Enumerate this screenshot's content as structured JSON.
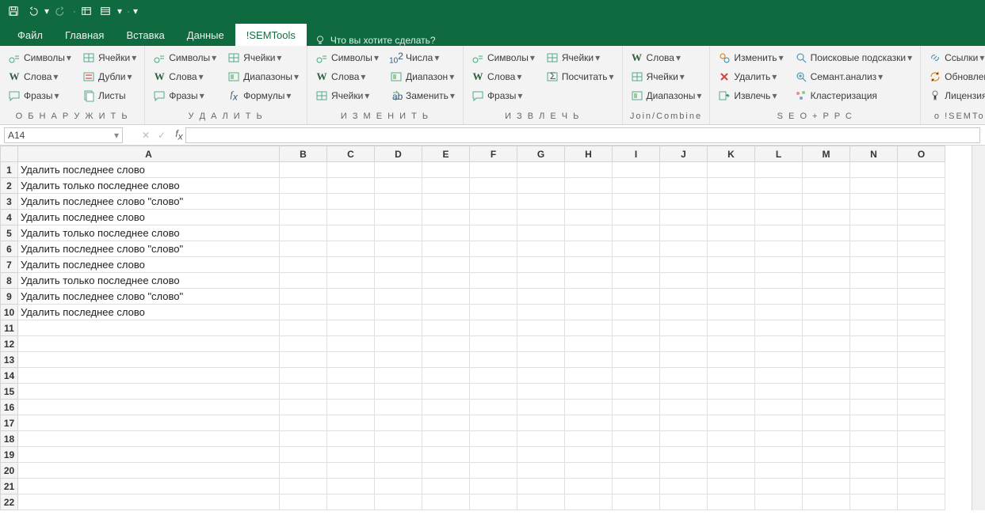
{
  "qat": {
    "save": "",
    "undo": "",
    "redo": ""
  },
  "tabs": {
    "file": "Файл",
    "home": "Главная",
    "insert": "Вставка",
    "data": "Данные",
    "semtools": "!SEMTools",
    "tellme": "Что вы хотите сделать?"
  },
  "ribbon": {
    "groups": [
      {
        "label": "О Б Н А Р У Ж И Т Ь",
        "cols": [
          [
            {
              "ic": "sym",
              "t": "Символы",
              "dd": 1
            },
            {
              "ic": "w",
              "t": "Слова",
              "dd": 1
            },
            {
              "ic": "phr",
              "t": "Фразы",
              "dd": 1
            }
          ],
          [
            {
              "ic": "cells",
              "t": "Ячейки",
              "dd": 1
            },
            {
              "ic": "dup",
              "t": "Дубли",
              "dd": 1
            },
            {
              "ic": "sheets",
              "t": "Листы"
            }
          ]
        ]
      },
      {
        "label": "У Д А Л И Т Ь",
        "cols": [
          [
            {
              "ic": "sym",
              "t": "Символы",
              "dd": 1
            },
            {
              "ic": "w",
              "t": "Слова",
              "dd": 1
            },
            {
              "ic": "phr",
              "t": "Фразы",
              "dd": 1
            }
          ],
          [
            {
              "ic": "cells",
              "t": "Ячейки",
              "dd": 1
            },
            {
              "ic": "rng",
              "t": "Диапазоны",
              "dd": 1
            },
            {
              "ic": "fx",
              "t": "Формулы",
              "dd": 1
            }
          ]
        ]
      },
      {
        "label": "И З М Е Н И Т Ь",
        "cols": [
          [
            {
              "ic": "sym",
              "t": "Символы",
              "dd": 1
            },
            {
              "ic": "w",
              "t": "Слова",
              "dd": 1
            },
            {
              "ic": "cells",
              "t": "Ячейки",
              "dd": 1
            }
          ],
          [
            {
              "ic": "num",
              "t": "Числа",
              "dd": 1
            },
            {
              "ic": "rng",
              "t": "Диапазон",
              "dd": 1
            },
            {
              "ic": "repl",
              "t": "Заменить",
              "dd": 1
            }
          ]
        ]
      },
      {
        "label": "И З В Л Е Ч Ь",
        "cols": [
          [
            {
              "ic": "sym",
              "t": "Символы",
              "dd": 1
            },
            {
              "ic": "w",
              "t": "Слова",
              "dd": 1
            },
            {
              "ic": "phr",
              "t": "Фразы",
              "dd": 1
            }
          ],
          [
            {
              "ic": "cells",
              "t": "Ячейки",
              "dd": 1
            },
            {
              "ic": "cnt",
              "t": "Посчитать",
              "dd": 1
            }
          ]
        ]
      },
      {
        "label": "Join/Combine",
        "cols": [
          [
            {
              "ic": "w",
              "t": "Слова",
              "dd": 1
            },
            {
              "ic": "cells",
              "t": "Ячейки",
              "dd": 1
            },
            {
              "ic": "rng",
              "t": "Диапазоны",
              "dd": 1
            }
          ]
        ]
      },
      {
        "label": "S E O + P P C",
        "cols": [
          [
            {
              "ic": "edit",
              "t": "Изменить",
              "dd": 1
            },
            {
              "ic": "del",
              "t": "Удалить",
              "dd": 1
            },
            {
              "ic": "ext",
              "t": "Извлечь",
              "dd": 1
            }
          ],
          [
            {
              "ic": "hint",
              "t": "Поисковые подсказки",
              "dd": 1
            },
            {
              "ic": "sem",
              "t": "Семант.анализ",
              "dd": 1
            },
            {
              "ic": "clu",
              "t": "Кластеризация"
            }
          ]
        ]
      },
      {
        "label": "о !SEMTools",
        "cols": [
          [
            {
              "ic": "link",
              "t": "Ссылки",
              "dd": 1
            },
            {
              "ic": "upd",
              "t": "Обновление",
              "dd": 1
            },
            {
              "ic": "lic",
              "t": "Лицензия",
              "dd": 1
            }
          ]
        ]
      }
    ]
  },
  "namebox": "A14",
  "columns": [
    "A",
    "B",
    "C",
    "D",
    "E",
    "F",
    "G",
    "H",
    "I",
    "J",
    "K",
    "L",
    "M",
    "N",
    "O"
  ],
  "rows": 22,
  "cells": {
    "A1": "Удалить последнее слово",
    "A2": "Удалить только последнее слово",
    "A3": "Удалить последнее слово \"слово\"",
    "A4": "Удалить последнее слово",
    "A5": "Удалить только последнее слово",
    "A6": "Удалить последнее слово \"слово\"",
    "A7": "Удалить последнее слово",
    "A8": "Удалить только последнее слово",
    "A9": "Удалить последнее слово \"слово\"",
    "A10": "Удалить последнее слово"
  }
}
